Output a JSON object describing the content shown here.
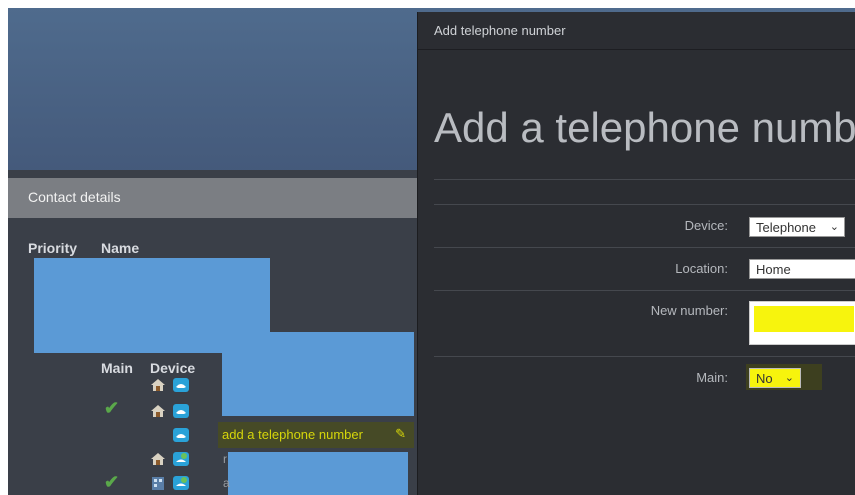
{
  "contact": {
    "header": "Contact details",
    "col_priority": "Priority",
    "col_name": "Name",
    "col_main": "Main",
    "col_device": "Device",
    "add_link_label": "add a telephone number",
    "partial_text_1": "r",
    "partial_text_2": "a"
  },
  "dialog": {
    "title": "Add telephone number",
    "heading": "Add a telephone numb",
    "device_label": "Device:",
    "device_value": "Telephone",
    "location_label": "Location:",
    "location_value": "Home",
    "new_number_label": "New number:",
    "main_label": "Main:",
    "main_value": "No"
  },
  "icons": {
    "home": "home-icon",
    "phone": "phone-icon",
    "check": "checkmark-icon",
    "edit": "edit-icon",
    "dropdown": "chevron-down-icon"
  },
  "colors": {
    "accent_yellow": "#f7f40d",
    "link_yellow": "#d6d60a",
    "redaction_blue": "#5b9ad6",
    "check_green": "#5aa84a"
  }
}
